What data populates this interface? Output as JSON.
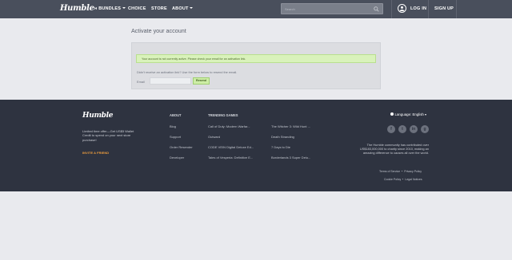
{
  "nav": {
    "logo": "Humble",
    "bundles": "BUNDLES",
    "choice": "CHOICE",
    "store": "STORE",
    "about": "ABOUT",
    "search_placeholder": "Search",
    "login": "LOG IN",
    "signup": "SIGN UP"
  },
  "main": {
    "title": "Activate your account",
    "alert": "Your account is not currently active. Please check your email for an activation link.",
    "resend_prompt": "Didn't receive an activation link? Use the form below to resend the email.",
    "email_label": "Email",
    "resend_button": "Resend"
  },
  "footer": {
    "logo": "Humble",
    "promo": "Limited time offer—Get US$5 Wallet Credit to spend on your next store purchase!",
    "invite": "INVITE A FRIEND",
    "about_head": "ABOUT",
    "about_links": [
      "Blog",
      "Support",
      "Order Resender",
      "Developer"
    ],
    "trending_head": "TRENDING GAMES",
    "trending_col1": [
      "Call of Duty: Modern Warfar...",
      "Outward",
      "CODE VEIN Digital Deluxe Ed...",
      "Tales of Vesperia: Definitive E..."
    ],
    "trending_col2": [
      "The Witcher 3: Wild Hunt ...",
      "Death Stranding",
      "7 Days to Die",
      "Borderlands 3 Super Delu..."
    ],
    "language": "Language: English",
    "social": [
      "f",
      "t",
      "in",
      "g"
    ],
    "charity": "The Humble community has contributed over US$183,000,000 to charity since 2010, making an amazing difference to causes all over the world.",
    "terms": "Terms of Service",
    "privacy": "Privacy Policy",
    "cookie": "Cookie Policy",
    "legal": "Legal Notices"
  }
}
